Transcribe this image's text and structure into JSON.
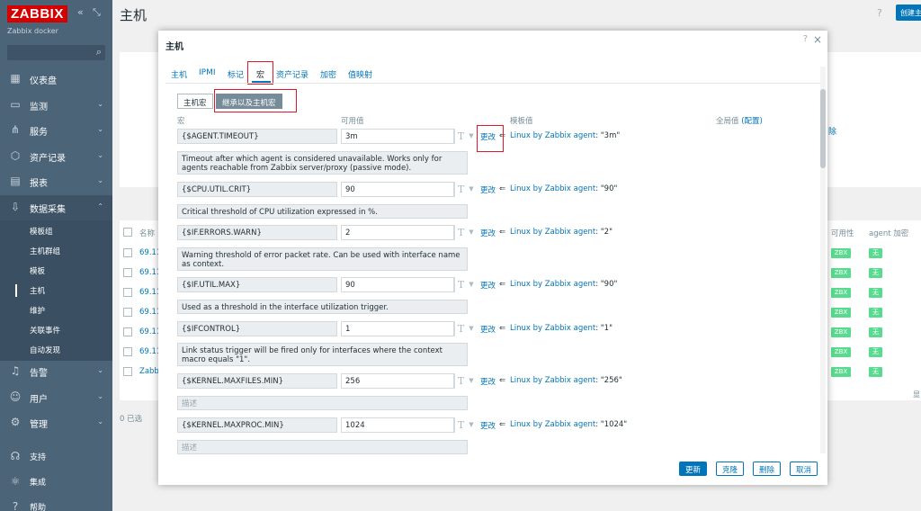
{
  "sidebar": {
    "logo": "ZABBIX",
    "collapse_icon": "«",
    "kiosk_icon": "⤡",
    "subtitle": "Zabbix docker",
    "search_placeholder": "",
    "items": [
      {
        "label": "仪表盘",
        "icon": "dashboard-icon"
      },
      {
        "label": "监测",
        "icon": "monitor-icon"
      },
      {
        "label": "服务",
        "icon": "services-icon"
      },
      {
        "label": "资产记录",
        "icon": "inventory-icon"
      },
      {
        "label": "报表",
        "icon": "reports-icon"
      },
      {
        "label": "数据采集",
        "icon": "data-collection-icon"
      },
      {
        "label": "告警",
        "icon": "bell-icon"
      },
      {
        "label": "用户",
        "icon": "users-icon"
      },
      {
        "label": "管理",
        "icon": "gear-icon"
      },
      {
        "label": "支持",
        "icon": "headset-icon"
      },
      {
        "label": "集成",
        "icon": "integrations-icon"
      },
      {
        "label": "帮助",
        "icon": "help-icon"
      }
    ],
    "sub_items": [
      "模板组",
      "主机群组",
      "模板",
      "主机",
      "维护",
      "关联事件",
      "自动发现"
    ],
    "active_sub": "主机"
  },
  "page": {
    "title": "主机",
    "help": "?",
    "create_button": "创建主",
    "bg_delete": "除",
    "table_headers": {
      "name": "名称",
      "availability": "可用性",
      "agent_encryption": "agent 加密"
    },
    "rows": [
      "69.11",
      "69.11",
      "69.11",
      "69.11",
      "69.11",
      "69.11",
      "Zabb"
    ],
    "availability_badge": "ZBX",
    "encryption_badge": "无",
    "selected": "0 已选",
    "edge_text": "显"
  },
  "modal": {
    "title": "主机",
    "help": "?",
    "close": "×",
    "tabs": [
      "主机",
      "IPMI",
      "标记",
      "宏",
      "资产记录",
      "加密",
      "值映射"
    ],
    "active_tab": "宏",
    "segments": [
      "主机宏",
      "继承以及主机宏"
    ],
    "active_segment": "继承以及主机宏",
    "columns": {
      "macro": "宏",
      "effective": "可用值",
      "template": "模板值",
      "global": "全局值",
      "global_link": "(配置)"
    },
    "change_label": "更改",
    "arrow": "⇐",
    "type_glyph": "T",
    "macros": [
      {
        "name": "{$AGENT.TIMEOUT}",
        "value": "3m",
        "description": "Timeout after which agent is considered unavailable. Works only for agents reachable from Zabbix server/proxy (passive mode).",
        "template": "Linux by Zabbix agent",
        "template_value": ": \"3m\""
      },
      {
        "name": "{$CPU.UTIL.CRIT}",
        "value": "90",
        "description": "Critical threshold of CPU utilization expressed in %.",
        "template": "Linux by Zabbix agent",
        "template_value": ": \"90\""
      },
      {
        "name": "{$IF.ERRORS.WARN}",
        "value": "2",
        "description": "Warning threshold of error packet rate. Can be used with interface name as context.",
        "template": "Linux by Zabbix agent",
        "template_value": ": \"2\""
      },
      {
        "name": "{$IF.UTIL.MAX}",
        "value": "90",
        "description": "Used as a threshold in the interface utilization trigger.",
        "template": "Linux by Zabbix agent",
        "template_value": ": \"90\""
      },
      {
        "name": "{$IFCONTROL}",
        "value": "1",
        "description": "Link status trigger will be fired only for interfaces where the context macro equals \"1\".",
        "template": "Linux by Zabbix agent",
        "template_value": ": \"1\""
      },
      {
        "name": "{$KERNEL.MAXFILES.MIN}",
        "value": "256",
        "description": "描述",
        "template": "Linux by Zabbix agent",
        "template_value": ": \"256\""
      },
      {
        "name": "{$KERNEL.MAXPROC.MIN}",
        "value": "1024",
        "description": "描述",
        "template": "Linux by Zabbix agent",
        "template_value": ": \"1024\""
      }
    ],
    "buttons": {
      "update": "更新",
      "clone": "克隆",
      "delete": "删除",
      "cancel": "取消"
    }
  }
}
